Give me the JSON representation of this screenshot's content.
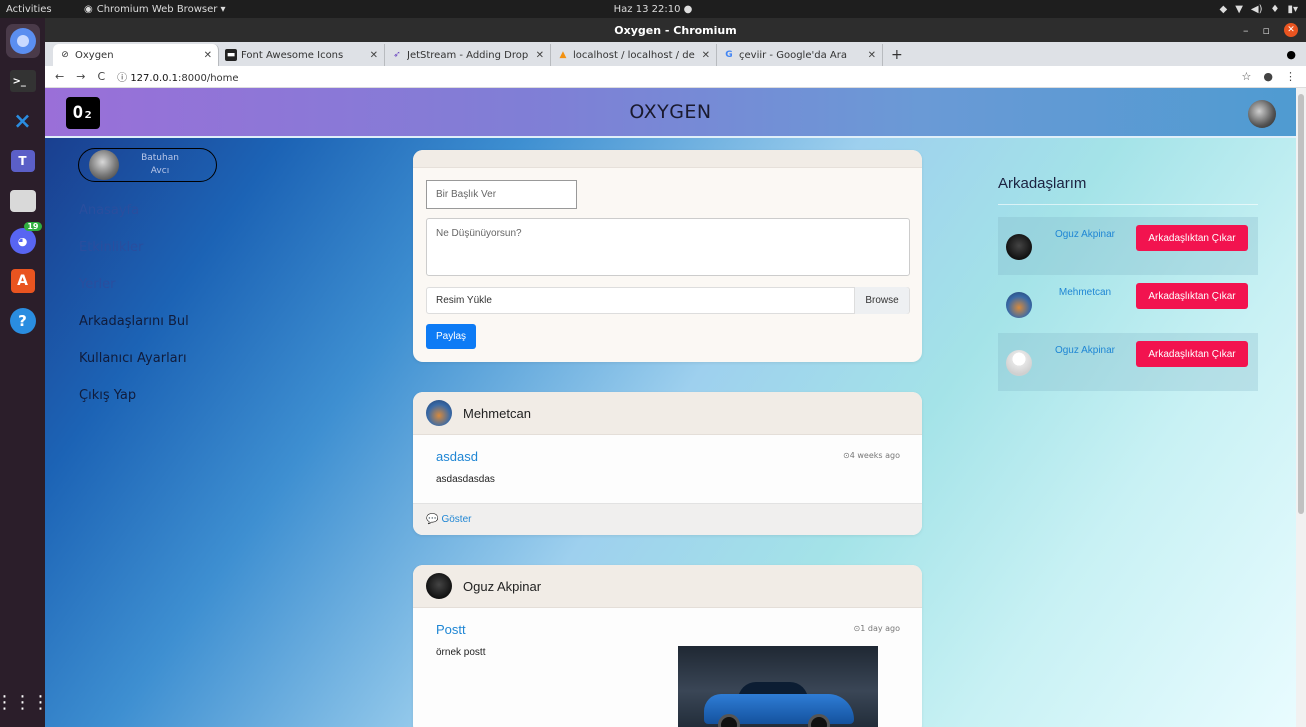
{
  "system": {
    "activities": "Activities",
    "app_name": "Chromium Web Browser ▾",
    "clock": "Haz 13  22:10  ●",
    "dock_badge": "19"
  },
  "browser": {
    "window_title": "Oxygen - Chromium",
    "tabs": [
      {
        "title": "Oxygen",
        "icon": "globe-icon"
      },
      {
        "title": "Font Awesome Icons",
        "icon": "flag-icon"
      },
      {
        "title": "JetStream - Adding Drop",
        "icon": "arrow-icon"
      },
      {
        "title": "localhost / localhost / de",
        "icon": "phpmyadmin-icon"
      },
      {
        "title": "çeviir - Google'da Ara",
        "icon": "google-icon"
      }
    ],
    "new_tab": "+",
    "url_info": "ⓘ",
    "url_host": "127.0.0.1",
    "url_path": ":8000/home"
  },
  "page": {
    "logo_text": "O₂",
    "brand": "OXYGEN",
    "profile": {
      "first_name": "Batuhan",
      "last_name": "Avcı"
    },
    "menu": [
      {
        "label": "Anasayfa",
        "tone": "blue"
      },
      {
        "label": "Etkinlikler",
        "tone": "blue"
      },
      {
        "label": "Yerler",
        "tone": "blue"
      },
      {
        "label": "Arkadaşlarını Bul",
        "tone": "dark"
      },
      {
        "label": "Kullanıcı Ayarları",
        "tone": "dark"
      },
      {
        "label": "Çıkış Yap",
        "tone": "dark"
      }
    ],
    "compose": {
      "title_placeholder": "Bir Başlık Ver",
      "body_placeholder": "Ne Düşünüyorsun?",
      "file_label": "Resim Yükle",
      "browse_label": "Browse",
      "share_label": "Paylaş"
    },
    "posts": [
      {
        "author": "Mehmetcan",
        "title": "asdasd",
        "time": "⊙4 weeks ago",
        "body": "asdasdasdas",
        "footer": "Göster"
      },
      {
        "author": "Oguz Akpinar",
        "title": "Postt",
        "time": "⊙1 day ago",
        "body": "örnek postt"
      }
    ],
    "friends_title": "Arkadaşlarım",
    "friends": [
      {
        "name": "Oguz Akpinar",
        "action": "Arkadaşlıktan Çıkar"
      },
      {
        "name": "Mehmetcan",
        "action": "Arkadaşlıktan Çıkar"
      },
      {
        "name": "Oguz Akpinar",
        "action": "Arkadaşlıktan Çıkar"
      }
    ]
  },
  "colors": {
    "accent_blue": "#0d7bf5",
    "danger_red": "#f2134f",
    "link_blue": "#1f86d4"
  }
}
